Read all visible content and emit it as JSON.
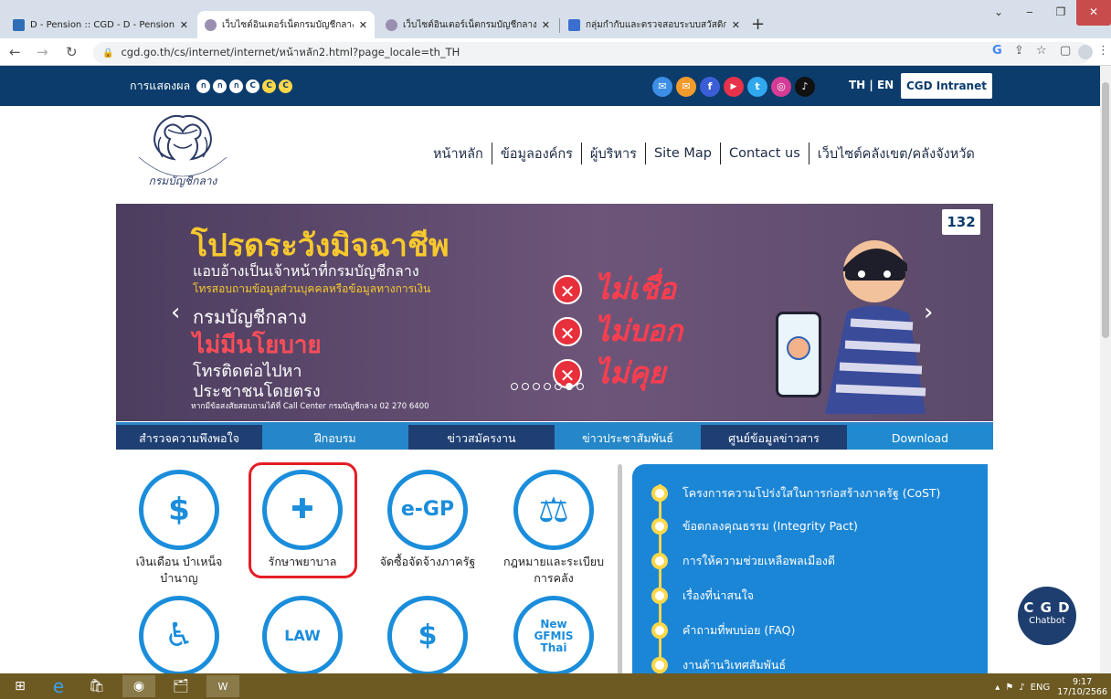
{
  "browser": {
    "tabs": [
      {
        "label": "D - Pension :: CGD - D - Pension",
        "favicon_color": "#2f6db6"
      },
      {
        "label": "เว็บไซต์อินเตอร์เน็ตกรมบัญชีกลาง",
        "favicon_color": "#9a8fb0"
      },
      {
        "label": "เว็บไซต์อินเตอร์เน็ตกรมบัญชีกลาง",
        "favicon_color": "#9a8fb0"
      },
      {
        "label": "กลุ่มกำกับและตรวจสอบระบบสวัสดิการ",
        "favicon_color": "#3a6fd0"
      }
    ],
    "new_tab": "+",
    "url": "cgd.go.th/cs/internet/internet/หน้าหลัก2.html?page_locale=th_TH"
  },
  "topbar": {
    "contrast_label": "การแสดงผล",
    "contrast_buttons": [
      "ก",
      "ก",
      "ก",
      "C",
      "C",
      "C"
    ],
    "social": [
      {
        "icon": "mail-icon",
        "glyph": "✉",
        "color": "#3d8ee6"
      },
      {
        "icon": "line-icon",
        "glyph": "✉",
        "color": "#f39a2d"
      },
      {
        "icon": "facebook-icon",
        "glyph": "f",
        "color": "#3b5ed6"
      },
      {
        "icon": "youtube-icon",
        "glyph": "▶",
        "color": "#e8314a"
      },
      {
        "icon": "twitter-icon",
        "glyph": "🐦",
        "color": "#2fa8ee"
      },
      {
        "icon": "instagram-icon",
        "glyph": "◎",
        "color": "#d43c96"
      },
      {
        "icon": "tiktok-icon",
        "glyph": "♪",
        "color": "#111111"
      }
    ],
    "lang": "TH | EN",
    "intranet": "CGD Intranet"
  },
  "logo_text": "กรมบัญชีกลาง",
  "nav": [
    "หน้าหลัก",
    "ข้อมูลองค์กร",
    "ผู้บริหาร",
    "Site Map",
    "Contact us",
    "เว็บไซต์คลังเขต/คลังจังหวัด"
  ],
  "banner": {
    "headline": "โปรดระวังมิจฉาชีพ",
    "sub1": "แอบอ้างเป็นเจ้าหน้าที่กรมบัญชีกลาง",
    "sub2": "โทรสอบถามข้อมูลส่วนบุคคลหรือข้อมูลทางการเงิน",
    "org": "กรมบัญชีกลาง",
    "policy": "ไม่มีนโยบาย",
    "call1": "โทรติดต่อไปหา",
    "call2": "ประชาชนโดยตรง",
    "footnote": "หากมีข้อสงสัยสอบถามได้ที่ Call Center กรมบัญชีกลาง 02 270 6400",
    "nots": [
      "ไม่เชื่อ",
      "ไม่บอก",
      "ไม่คุย"
    ],
    "badge": "132",
    "slide_count": 7,
    "active_slide": 6
  },
  "menu_tabs": [
    "สำรวจความพึงพอใจ",
    "ฝึกอบรม",
    "ข่าวสมัครงาน",
    "ข่าวประชาสัมพันธ์",
    "ศูนย์ข้อมูลข่าวสาร",
    "Download"
  ],
  "services": [
    {
      "label1": "เงินเดือน บำเหน็จ",
      "label2": "บำนาญ",
      "icon": "money-icon",
      "glyph": "$"
    },
    {
      "label1": "รักษาพยาบาล",
      "label2": "",
      "icon": "nurse-cap-icon",
      "glyph": "✚"
    },
    {
      "label1": "จัดซื้อจัดจ้างภาครัฐ",
      "label2": "",
      "icon": "egp-icon",
      "glyph": "e-GP"
    },
    {
      "label1": "กฎหมายและระเบียบ",
      "label2": "การคลัง",
      "icon": "scales-icon",
      "glyph": "⚖"
    },
    {
      "label1": "",
      "label2": "",
      "icon": "welfare-icon",
      "glyph": "♿"
    },
    {
      "label1": "",
      "label2": "",
      "icon": "law-book-icon",
      "glyph": "LAW"
    },
    {
      "label1": "",
      "label2": "",
      "icon": "coin-hand-icon",
      "glyph": "$"
    },
    {
      "label1": "",
      "label2": "",
      "icon": "gfmis-icon",
      "glyph": "New GFMIS Thai"
    }
  ],
  "right_links": [
    "โครงการความโปร่งใสในการก่อสร้างภาครัฐ (CoST)",
    "ข้อตกลงคุณธรรม (Integrity Pact)",
    "การให้ความช่วยเหลือพลเมืองดี",
    "เรื่องที่น่าสนใจ",
    "คำถามที่พบบ่อย (FAQ)",
    "งานด้านวิเทศสัมพันธ์"
  ],
  "chatbot": {
    "title": "C G D",
    "sub": "Chatbot"
  },
  "taskbar": {
    "lang": "ENG",
    "time": "9:17",
    "date": "17/10/2566"
  },
  "colors": {
    "site_navy": "#0b3c6c",
    "accent_blue": "#1a8ddb",
    "highlight_red": "#e41e25",
    "taskbar": "#6d5a22"
  }
}
